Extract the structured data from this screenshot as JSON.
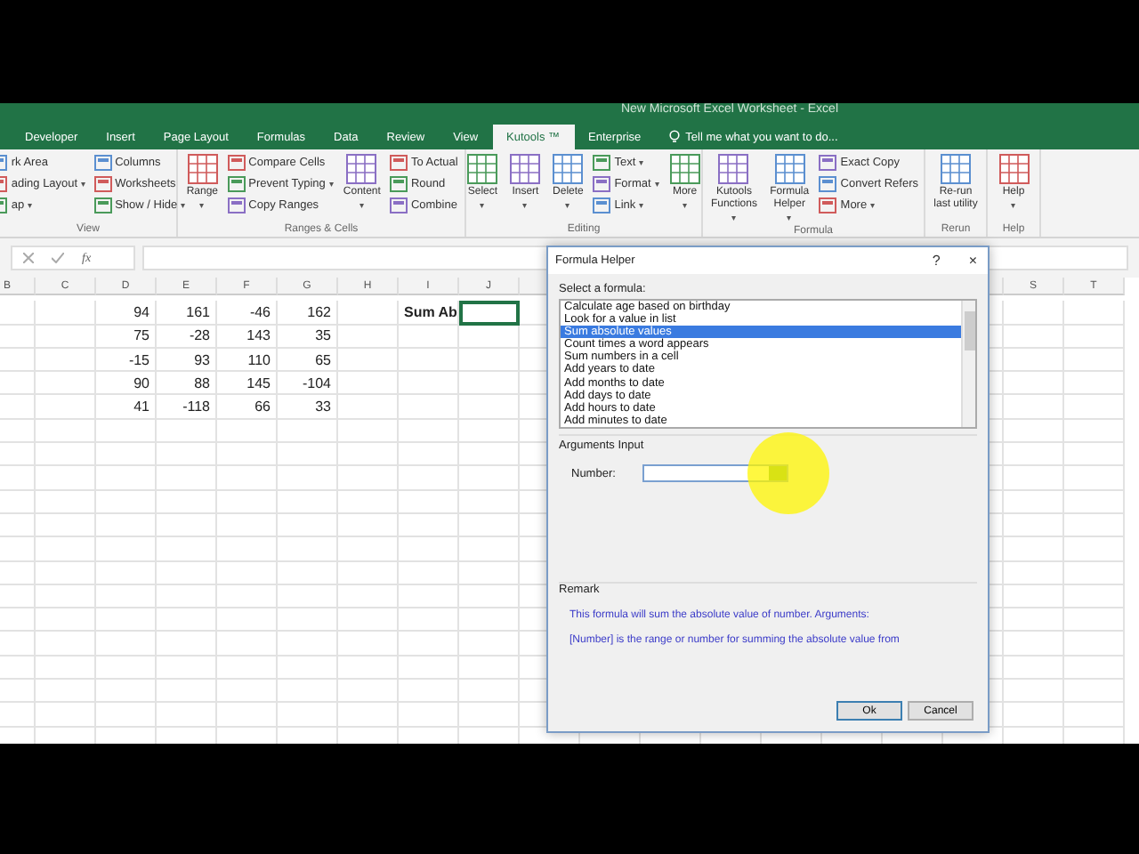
{
  "window": {
    "title": "New Microsoft Excel Worksheet - Excel"
  },
  "tabs": [
    {
      "label": "Developer",
      "selected": false
    },
    {
      "label": "Insert",
      "selected": false
    },
    {
      "label": "Page Layout",
      "selected": false
    },
    {
      "label": "Formulas",
      "selected": false
    },
    {
      "label": "Data",
      "selected": false
    },
    {
      "label": "Review",
      "selected": false
    },
    {
      "label": "View",
      "selected": false
    },
    {
      "label": "Kutools ™",
      "selected": true
    },
    {
      "label": "Enterprise",
      "selected": false
    }
  ],
  "tell_me": "Tell me what you want to do...",
  "ribbon": [
    {
      "label": "View",
      "columns": [
        {
          "kind": "stack",
          "items": [
            {
              "label": "rk Area"
            },
            {
              "label": "ading Layout",
              "caret": "▾"
            },
            {
              "label": "ap",
              "caret": "▾"
            }
          ]
        },
        {
          "kind": "stack",
          "items": [
            {
              "label": "Columns"
            },
            {
              "label": "Worksheets"
            },
            {
              "label": "Show / Hide",
              "caret": "▾"
            }
          ]
        }
      ]
    },
    {
      "label": "Ranges & Cells",
      "columns": [
        {
          "kind": "large",
          "label": "Range",
          "caret": "▾"
        },
        {
          "kind": "stack",
          "items": [
            {
              "label": "Compare Cells"
            },
            {
              "label": "Prevent Typing",
              "caret": "▾"
            },
            {
              "label": "Copy Ranges"
            }
          ]
        },
        {
          "kind": "large",
          "label": "Content",
          "caret": "▾"
        },
        {
          "kind": "stack",
          "items": [
            {
              "label": "To Actual"
            },
            {
              "label": "Round"
            },
            {
              "label": "Combine"
            }
          ]
        }
      ]
    },
    {
      "label": "Editing",
      "columns": [
        {
          "kind": "large",
          "label": "Select",
          "caret": "▾"
        },
        {
          "kind": "large",
          "label": "Insert",
          "caret": "▾"
        },
        {
          "kind": "large",
          "label": "Delete",
          "caret": "▾"
        },
        {
          "kind": "stack",
          "items": [
            {
              "label": "Text",
              "caret": "▾"
            },
            {
              "label": "Format",
              "caret": "▾"
            },
            {
              "label": "Link",
              "caret": "▾"
            }
          ]
        },
        {
          "kind": "large",
          "label": "More",
          "caret": "▾"
        }
      ]
    },
    {
      "label": "Formula",
      "columns": [
        {
          "kind": "large",
          "label": "Kutools Functions",
          "caret": "▾"
        },
        {
          "kind": "large",
          "label": "Formula Helper",
          "caret": "▾"
        },
        {
          "kind": "stack",
          "items": [
            {
              "label": "Exact Copy"
            },
            {
              "label": "Convert Refers"
            },
            {
              "label": "More",
              "caret": "▾"
            }
          ]
        }
      ]
    },
    {
      "label": "Rerun",
      "columns": [
        {
          "kind": "large",
          "label": "Re-run last utility"
        }
      ]
    },
    {
      "label": "Help",
      "columns": [
        {
          "kind": "large",
          "label": "Help",
          "caret": "▾"
        }
      ]
    }
  ],
  "formula_bar": {
    "fx": "fx"
  },
  "sheet": {
    "columns": [
      "B",
      "C",
      "D",
      "E",
      "F",
      "G",
      "H",
      "I",
      "J",
      "",
      "",
      "",
      "",
      "",
      "",
      "",
      "",
      "S",
      "T"
    ],
    "rows": [
      {
        "cells": [
          {
            "selected": false
          },
          {
            "selected": false
          },
          {
            "value": "94",
            "selected": false
          },
          {
            "value": "161",
            "selected": false
          },
          {
            "value": "-46",
            "selected": false
          },
          {
            "value": "162",
            "selected": false
          },
          {
            "selected": false
          },
          {
            "value": "Sum Ab",
            "bold": true,
            "selected": false
          },
          {
            "selected": true
          }
        ]
      },
      {
        "cells": [
          {
            "selected": false
          },
          {
            "selected": false
          },
          {
            "value": "75",
            "selected": false
          },
          {
            "value": "-28",
            "selected": false
          },
          {
            "value": "143",
            "selected": false
          },
          {
            "value": "35",
            "selected": false
          }
        ]
      },
      {
        "cells": [
          {
            "selected": false
          },
          {
            "selected": false
          },
          {
            "value": "-15",
            "selected": false
          },
          {
            "value": "93",
            "selected": false
          },
          {
            "value": "110",
            "selected": false
          },
          {
            "value": "65",
            "selected": false
          }
        ]
      },
      {
        "cells": [
          {
            "selected": false
          },
          {
            "selected": false
          },
          {
            "value": "90",
            "selected": false
          },
          {
            "value": "88",
            "selected": false
          },
          {
            "value": "145",
            "selected": false
          },
          {
            "value": "-104",
            "selected": false
          }
        ]
      },
      {
        "cells": [
          {
            "selected": false
          },
          {
            "selected": false
          },
          {
            "value": "41",
            "selected": false
          },
          {
            "value": "-118",
            "selected": false
          },
          {
            "value": "66",
            "selected": false
          },
          {
            "value": "33",
            "selected": false
          }
        ]
      }
    ]
  },
  "dialog": {
    "title": "Formula Helper",
    "help": "?",
    "close": "×",
    "select_label": "Select a formula:",
    "formulas": [
      {
        "label": "Calculate age based on birthday",
        "selected": false
      },
      {
        "label": "Look for a value in list",
        "selected": false
      },
      {
        "label": "Sum absolute values",
        "selected": true
      },
      {
        "label": "Count times a word appears",
        "selected": false
      },
      {
        "label": "Sum numbers in a cell",
        "selected": false
      },
      {
        "label": "Add years to date",
        "selected": false
      },
      {
        "label": "Add months to date",
        "selected": false
      },
      {
        "label": "Add days to date",
        "selected": false
      },
      {
        "label": "Add hours to date",
        "selected": false
      },
      {
        "label": "Add minutes to date",
        "selected": false
      }
    ],
    "arguments_label": "Arguments Input",
    "argument": {
      "label": "Number:"
    },
    "remark_label": "Remark",
    "remark": [
      "This formula will sum the absolute value of number. Arguments:",
      "[Number] is the range or number for summing the absolute value from"
    ],
    "buttons": [
      "Ok",
      "Cancel"
    ]
  }
}
